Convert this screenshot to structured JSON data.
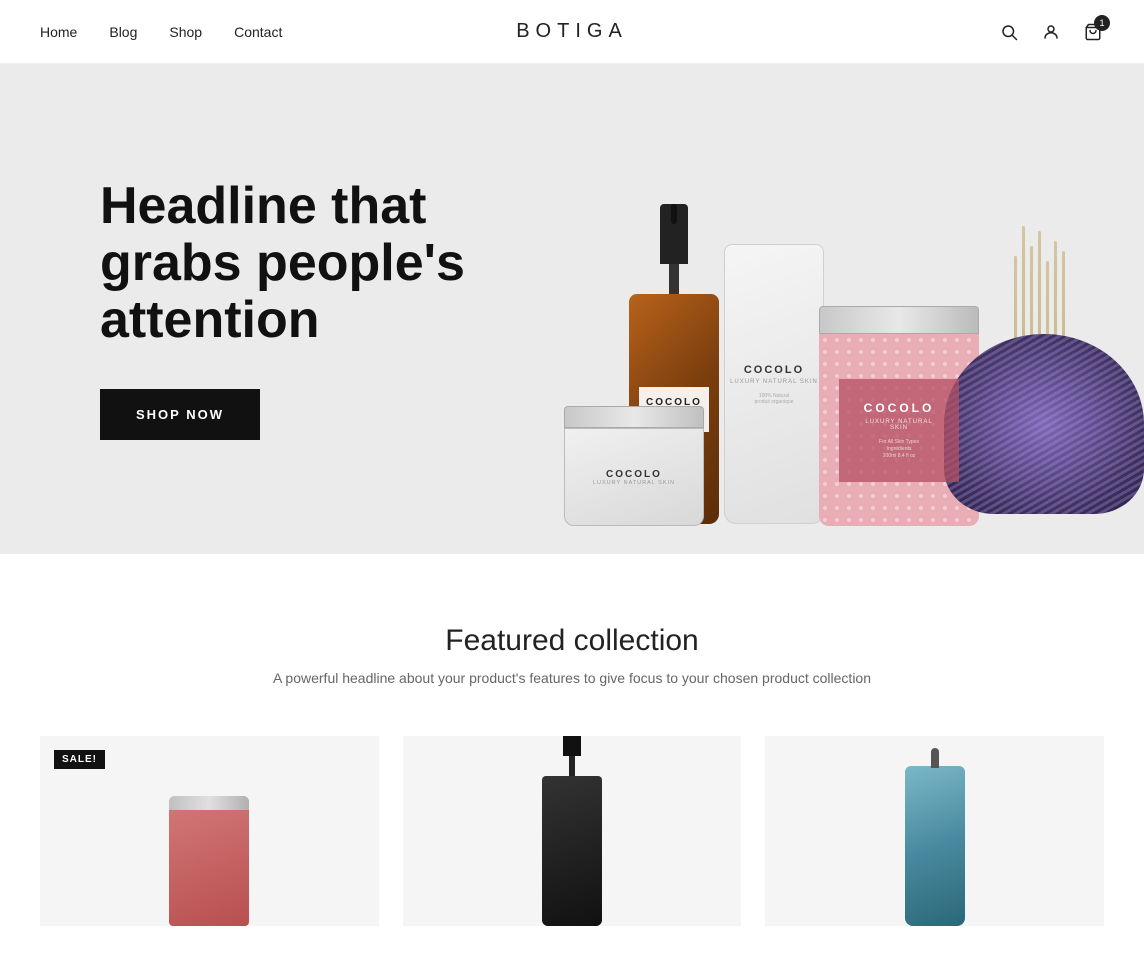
{
  "nav": {
    "logo": "BOTIGA",
    "links": [
      {
        "id": "home",
        "label": "Home"
      },
      {
        "id": "blog",
        "label": "Blog"
      },
      {
        "id": "shop",
        "label": "Shop"
      },
      {
        "id": "contact",
        "label": "Contact"
      }
    ],
    "cart_count": "1"
  },
  "hero": {
    "headline": "Headline that grabs people's attention",
    "cta_label": "SHOP NOW"
  },
  "featured": {
    "title": "Featured collection",
    "subtitle": "A powerful headline about your product's features to give focus to your chosen product collection",
    "sale_badge": "SALE!"
  }
}
